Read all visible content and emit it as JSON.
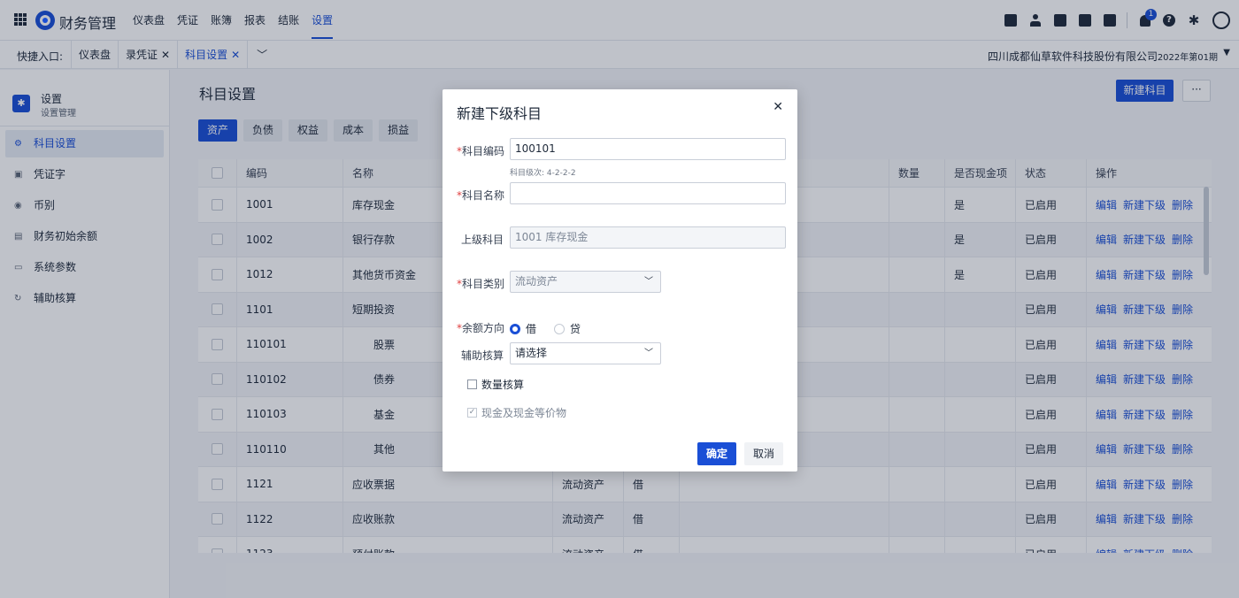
{
  "app": {
    "title": "财务管理"
  },
  "topnav": [
    "仪表盘",
    "凭证",
    "账簿",
    "报表",
    "结账",
    "设置"
  ],
  "notifications": {
    "count": "1"
  },
  "quickbar": {
    "label": "快捷入口:",
    "tabs": [
      {
        "label": "仪表盘",
        "close": ""
      },
      {
        "label": "录凭证",
        "close": "✕"
      },
      {
        "label": "科目设置",
        "close": "✕"
      }
    ],
    "company": "四川成都仙草软件科技股份有限公司",
    "period": "2022年第01期"
  },
  "sidebar": {
    "title": "设置",
    "subtitle": "设置管理",
    "items": [
      "科目设置",
      "凭证字",
      "币别",
      "财务初始余额",
      "系统参数",
      "辅助核算"
    ]
  },
  "main": {
    "title": "科目设置",
    "new_button": "新建科目",
    "more_button": "···",
    "category_tabs": [
      "资产",
      "负债",
      "权益",
      "成本",
      "损益"
    ]
  },
  "table": {
    "headers": [
      "",
      "编码",
      "名称",
      "",
      "",
      "",
      "数量",
      "是否现金项",
      "状态",
      "操作"
    ],
    "actions": [
      "编辑",
      "新建下级",
      "删除"
    ],
    "rows": [
      {
        "code": "1001",
        "name": "库存现金",
        "type": "",
        "dir": "",
        "cash": "是",
        "status": "已启用"
      },
      {
        "code": "1002",
        "name": "银行存款",
        "type": "",
        "dir": "",
        "cash": "是",
        "status": "已启用"
      },
      {
        "code": "1012",
        "name": "其他货币资金",
        "type": "",
        "dir": "",
        "cash": "是",
        "status": "已启用"
      },
      {
        "code": "1101",
        "name": "短期投资",
        "type": "",
        "dir": "",
        "cash": "",
        "status": "已启用"
      },
      {
        "code": "110101",
        "name": "股票",
        "type": "",
        "dir": "",
        "cash": "",
        "status": "已启用"
      },
      {
        "code": "110102",
        "name": "债券",
        "type": "",
        "dir": "",
        "cash": "",
        "status": "已启用"
      },
      {
        "code": "110103",
        "name": "基金",
        "type": "",
        "dir": "",
        "cash": "",
        "status": "已启用"
      },
      {
        "code": "110110",
        "name": "其他",
        "type": "",
        "dir": "",
        "cash": "",
        "status": "已启用"
      },
      {
        "code": "1121",
        "name": "应收票据",
        "type": "流动资产",
        "dir": "借",
        "cash": "",
        "status": "已启用"
      },
      {
        "code": "1122",
        "name": "应收账款",
        "type": "流动资产",
        "dir": "借",
        "cash": "",
        "status": "已启用"
      },
      {
        "code": "1123",
        "name": "预付账款",
        "type": "流动资产",
        "dir": "借",
        "cash": "",
        "status": "已启用"
      }
    ]
  },
  "modal": {
    "title": "新建下级科目",
    "close": "✕",
    "code_label": "科目编码",
    "code_value": "100101",
    "code_hint": "科目级次: 4-2-2-2",
    "name_label": "科目名称",
    "name_value": "",
    "parent_label": "上级科目",
    "parent_value": "1001 库存现金",
    "category_label": "科目类别",
    "category_value": "流动资产",
    "direction_label": "余额方向",
    "direction_options": [
      "借",
      "贷"
    ],
    "direction_selected": "借",
    "aux_label": "辅助核算",
    "aux_placeholder": "请选择",
    "quantity_check": "数量核算",
    "cash_check": "现金及现金等价物",
    "ok": "确定",
    "cancel": "取消"
  },
  "colors": {
    "accent": "#1a4fd6",
    "required": "#e04141"
  }
}
